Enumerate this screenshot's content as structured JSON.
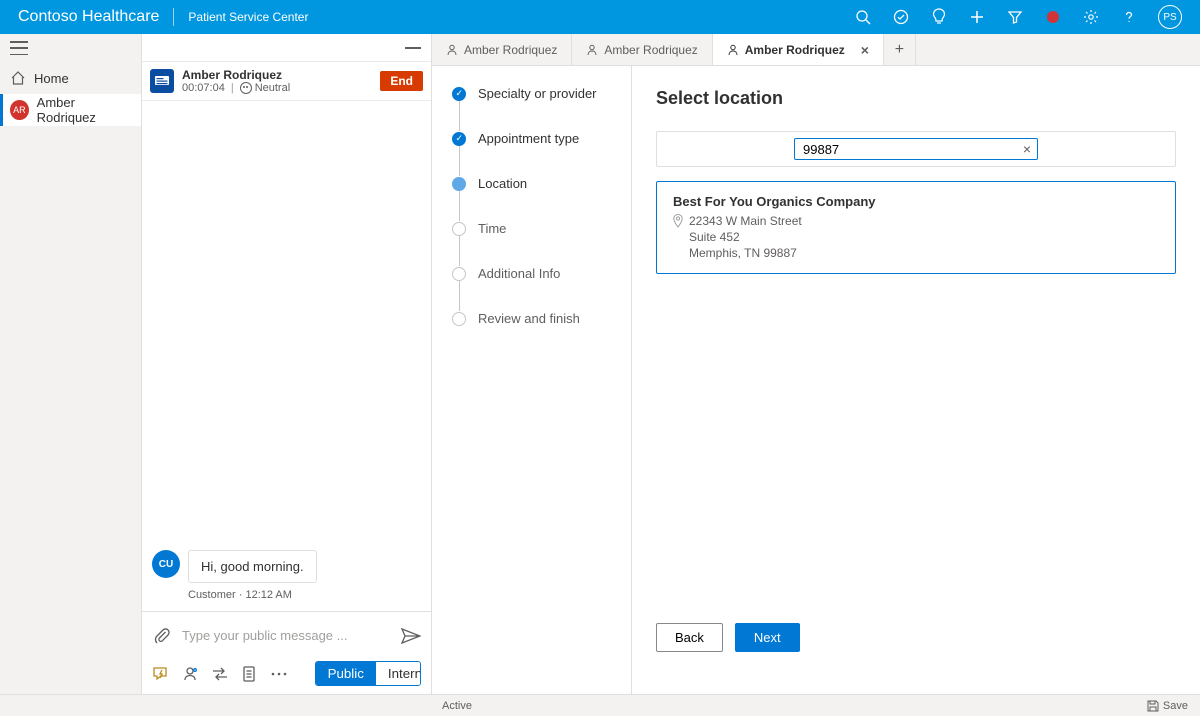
{
  "topbar": {
    "brand": "Contoso Healthcare",
    "app": "Patient Service Center",
    "avatar_initials": "PS"
  },
  "leftrail": {
    "home": "Home",
    "active_contact": "Amber Rodriquez",
    "active_initials": "AR"
  },
  "conversation": {
    "name": "Amber Rodriquez",
    "timer": "00:07:04",
    "sentiment": "Neutral",
    "end": "End",
    "message": {
      "avatar": "CU",
      "text": "Hi, good morning.",
      "meta": "Customer · 12:12 AM"
    },
    "compose_placeholder": "Type your public message ...",
    "toggle_public": "Public",
    "toggle_internal": "Internal"
  },
  "tabs": {
    "items": [
      {
        "label": "Amber Rodriquez"
      },
      {
        "label": "Amber Rodriquez"
      },
      {
        "label": "Amber Rodriquez"
      }
    ]
  },
  "wizard": {
    "steps": [
      {
        "label": "Specialty or provider"
      },
      {
        "label": "Appointment type"
      },
      {
        "label": "Location"
      },
      {
        "label": "Time"
      },
      {
        "label": "Additional Info"
      },
      {
        "label": "Review and finish"
      }
    ]
  },
  "detail": {
    "heading": "Select location",
    "search_value": "99887",
    "result": {
      "title": "Best For You Organics Company",
      "addr1": "22343 W Main Street",
      "addr2": "Suite 452",
      "addr3": "Memphis, TN 99887"
    },
    "back": "Back",
    "next": "Next"
  },
  "statusbar": {
    "status": "Active",
    "save": "Save"
  }
}
